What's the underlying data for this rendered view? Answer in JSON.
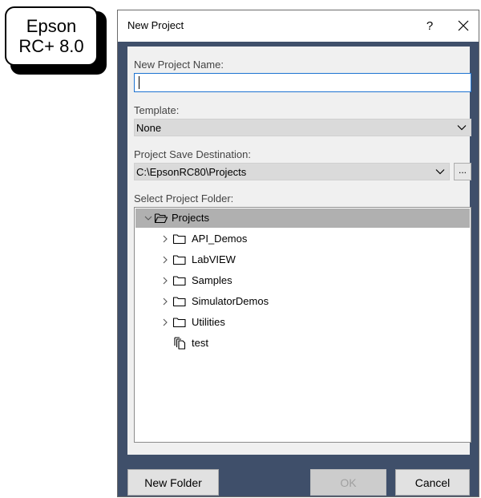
{
  "callout": {
    "line1": "Epson",
    "line2": "RC+ 8.0"
  },
  "dialog": {
    "title": "New Project",
    "help_label": "?",
    "close_icon": "close-icon",
    "project_name": {
      "label": "New Project Name:",
      "value": "",
      "placeholder": ""
    },
    "template": {
      "label": "Template:",
      "selected": "None"
    },
    "destination": {
      "label": "Project Save Destination:",
      "selected": "C:\\EpsonRC80\\Projects",
      "browse_label": "..."
    },
    "folder_tree": {
      "label": "Select Project Folder:",
      "root": "Projects",
      "children": [
        "API_Demos",
        "LabVIEW",
        "Samples",
        "SimulatorDemos",
        "Utilities"
      ],
      "project_item": "test"
    },
    "buttons": {
      "new_folder": "New Folder",
      "ok": "OK",
      "cancel": "Cancel"
    },
    "colors": {
      "accent_border": "#1e73d1",
      "dialog_frame": "#3f4f6a",
      "selected_row": "#b0b0b0"
    }
  }
}
